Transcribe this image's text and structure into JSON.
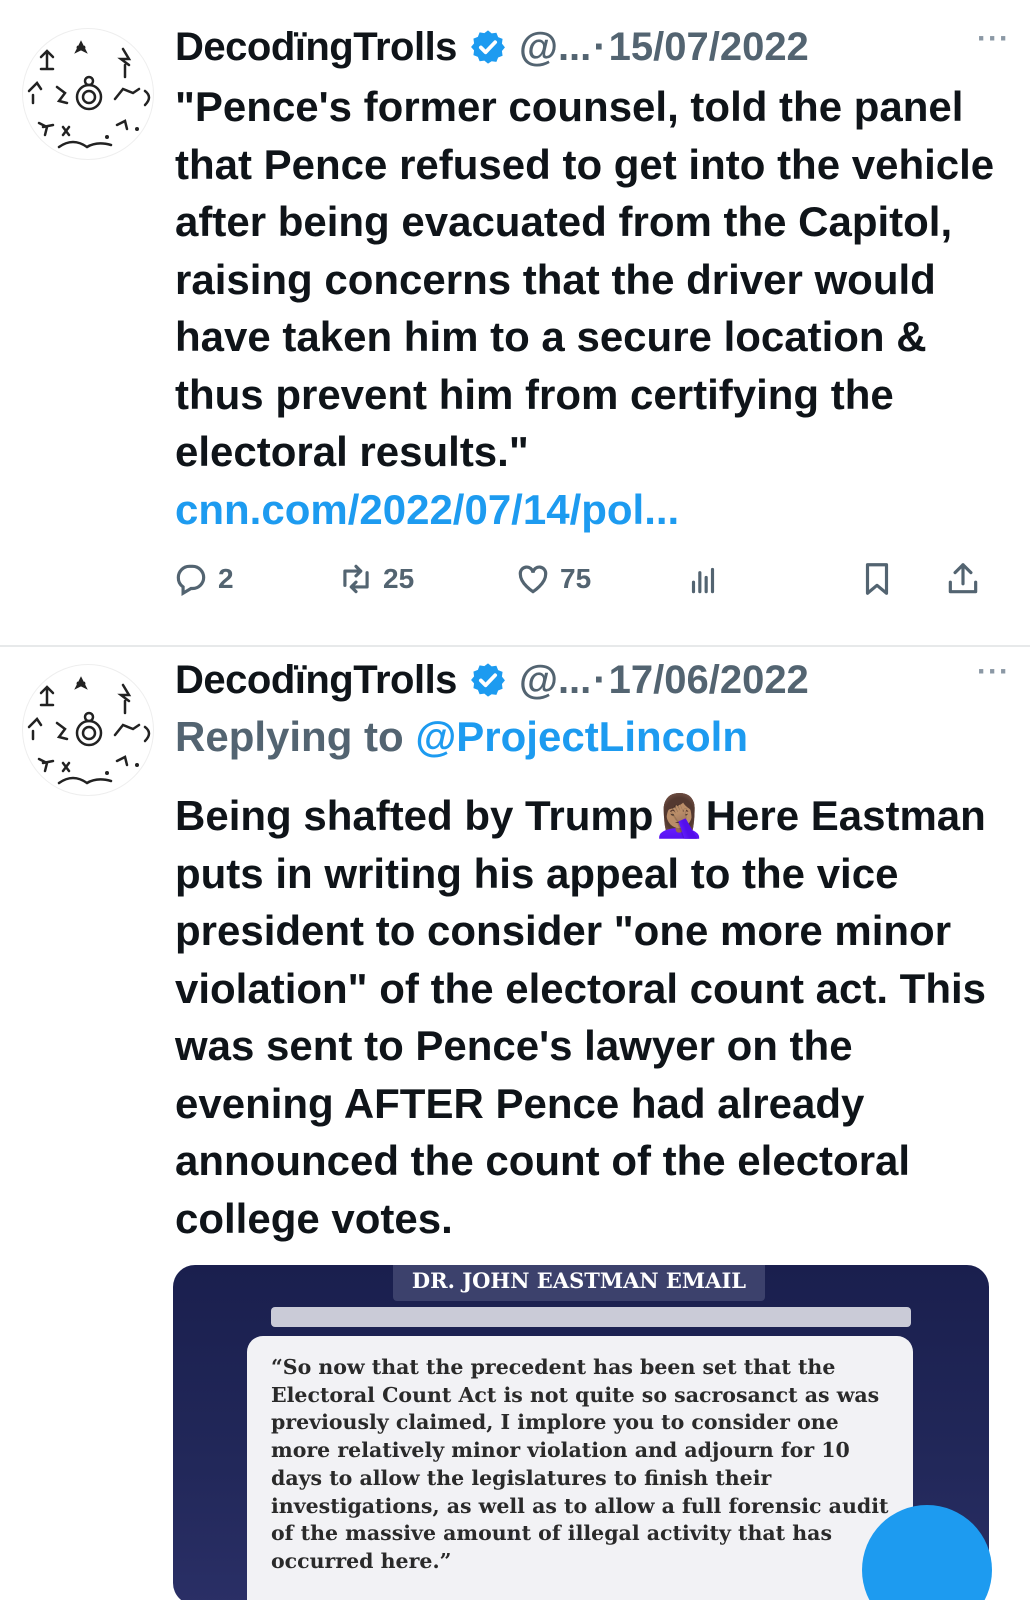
{
  "tweets": [
    {
      "author_name": "DecodïngTrolls",
      "handle": "@...",
      "separator": "·",
      "date": "15/07/2022",
      "more": "···",
      "text": "\"Pence's former counsel, told the panel that Pence refused to get into the vehicle after being evacuated from the Capitol, raising concerns that the driver would have taken him to a secure location & thus prevent him from certifying the electoral results.\" ",
      "link": "cnn.com/2022/07/14/pol...",
      "replies": "2",
      "retweets": "25",
      "likes": "75"
    },
    {
      "author_name": "DecodïngTrolls",
      "handle": "@...",
      "separator": "·",
      "date": "17/06/2022",
      "more": "···",
      "replying_prefix": "Replying to ",
      "replying_mention": "@ProjectLincoln",
      "text_part1": "Being shafted by Trump",
      "emoji": "🤦🏽‍♀️",
      "text_part2": "Here Eastman puts in writing his appeal to the vice president to consider \"one more minor violation\" of the electoral count act. This was sent to Pence's lawyer on the evening AFTER Pence had already announced the count of the electoral college votes.",
      "media_title": "DR. JOHN EASTMAN EMAIL",
      "media_quote": "“So now that the precedent has been set that the Electoral Count Act is not quite so sacrosanct as was previously claimed, I implore you to consider one more relatively minor violation and adjourn for 10 days to allow the legislatures to finish their investigations, as well as to allow a full forensic audit of the massive amount of illegal activity that has occurred here.”"
    }
  ],
  "colors": {
    "accent": "#1d9bf0",
    "muted": "#536471",
    "text": "#0f1419"
  },
  "icons": [
    "verified-badge-icon",
    "more-icon",
    "reply-icon",
    "retweet-icon",
    "like-icon",
    "views-icon",
    "bookmark-icon",
    "share-icon",
    "compose-fab-icon"
  ]
}
